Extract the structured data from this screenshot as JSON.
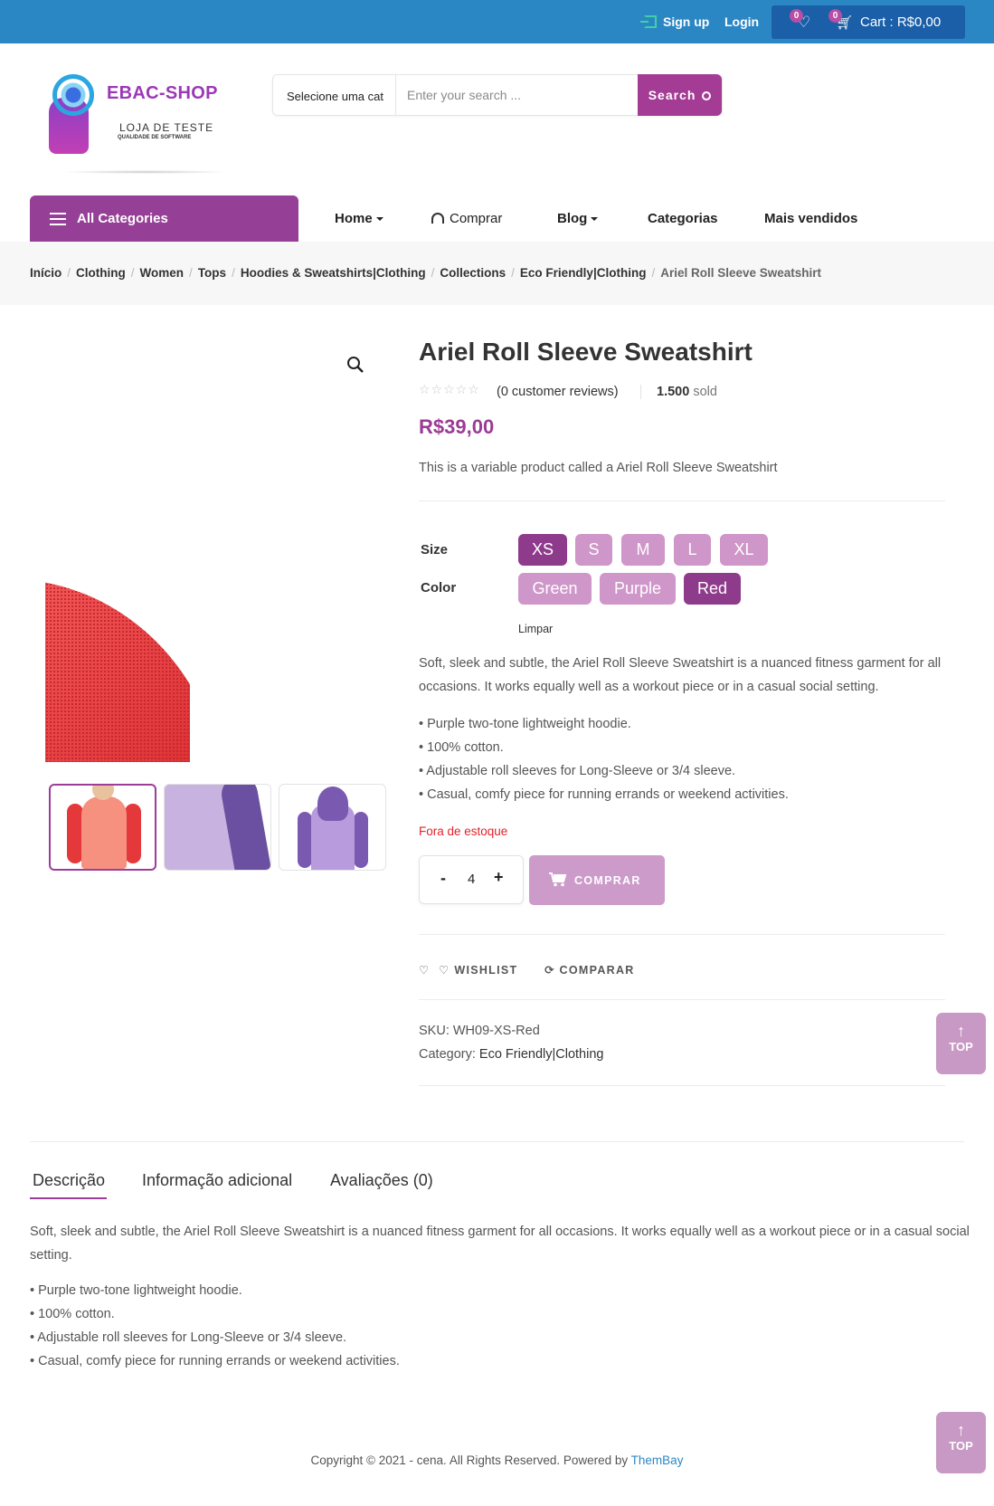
{
  "header": {
    "signup": "Sign up",
    "login": "Login",
    "wishlist_count": "0",
    "cart_count": "0",
    "cart_label": "Cart : R$0,00"
  },
  "logo": {
    "title": "EBAC-SHOP",
    "subtitle": "LOJA DE TESTE",
    "tagline": "QUALIDADE DE SOFTWARE"
  },
  "search": {
    "category": "Selecione uma cat",
    "placeholder": "Enter your search ...",
    "button": "Search"
  },
  "nav": {
    "all_categories": "All Categories",
    "items": [
      {
        "label": "Home",
        "dropdown": true
      },
      {
        "label": "Comprar",
        "icon": "headset-icon"
      },
      {
        "label": "Blog",
        "dropdown": true
      },
      {
        "label": "Categorias"
      },
      {
        "label": "Mais vendidos"
      }
    ]
  },
  "breadcrumb": [
    "Início",
    "Clothing",
    "Women",
    "Tops",
    "Hoodies & Sweatshirts|Clothing",
    "Collections",
    "Eco Friendly|Clothing",
    "Ariel Roll Sleeve Sweatshirt"
  ],
  "product": {
    "title": "Ariel Roll Sleeve Sweatshirt",
    "rating": 0,
    "reviews": "(0 customer reviews)",
    "sold_count": "1.500",
    "sold_label": "sold",
    "price": "R$39,00",
    "short_description": "This is a variable product called a Ariel Roll Sleeve Sweatshirt",
    "attributes": {
      "size_label": "Size",
      "sizes": [
        "XS",
        "S",
        "M",
        "L",
        "XL"
      ],
      "selected_size": "XS",
      "color_label": "Color",
      "colors": [
        "Green",
        "Purple",
        "Red"
      ],
      "selected_color": "Red",
      "clear": "Limpar"
    },
    "description": "Soft, sleek and subtle, the Ariel Roll Sleeve Sweatshirt is a nuanced fitness garment for all occasions. It works equally well as a workout piece or in a casual social setting.",
    "bullets": [
      "• Purple two-tone lightweight hoodie.",
      "• 100% cotton.",
      "• Adjustable roll sleeves for Long-Sleeve or 3/4 sleeve.",
      "• Casual, comfy piece for running errands or weekend activities."
    ],
    "stock": "Fora de estoque",
    "quantity": "4",
    "qty_minus": "-",
    "qty_plus": "+",
    "buy_button": "COMPRAR",
    "wishlist": "WISHLIST",
    "compare": "COMPARAR",
    "sku_label": "SKU:",
    "sku": "WH09-XS-Red",
    "category_label": "Category:",
    "category": "Eco Friendly|Clothing"
  },
  "tabs": {
    "items": [
      "Descrição",
      "Informação adicional",
      "Avaliações (0)"
    ],
    "active": "Descrição",
    "description": "Soft, sleek and subtle, the Ariel Roll Sleeve Sweatshirt is a nuanced fitness garment for all occasions. It works equally well as a workout piece or in a casual social setting.",
    "bullets": [
      "• Purple two-tone lightweight hoodie.",
      "• 100% cotton.",
      "• Adjustable roll sleeves for Long-Sleeve or 3/4 sleeve.",
      "• Casual, comfy piece for running errands or weekend activities."
    ]
  },
  "top_button": "TOP",
  "footer": {
    "text": "Copyright © 2021 - cena. All Rights Reserved. Powered by",
    "link": "ThemBay"
  },
  "colors": {
    "topbar": "#2b87c4",
    "brand_purple": "#963f96",
    "swatch": "#cf96c9",
    "swatch_selected": "#8f3b8c",
    "out_of_stock": "#e2232a"
  }
}
